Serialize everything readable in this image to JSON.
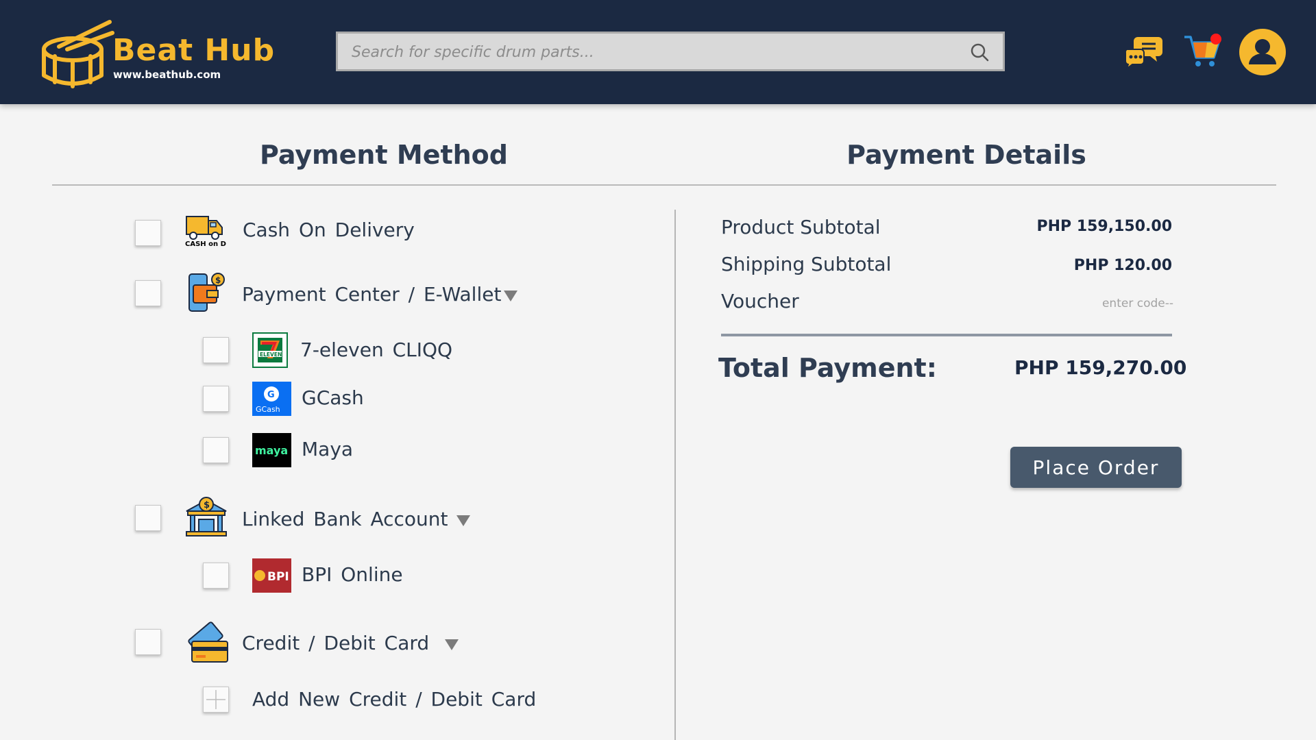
{
  "header": {
    "brand_name": "Beat Hub",
    "brand_url": "www.beathub.com",
    "search_placeholder": "Search for specific drum parts...",
    "cart_badge_color": "#ff1b1b",
    "brand_color": "#f5b82e",
    "background_color": "#1b2942"
  },
  "payment_method": {
    "title": "Payment Method",
    "options": [
      {
        "label": "Cash On  Delivery",
        "icon": "cash-on-delivery-van-icon",
        "icon_text": "CASH on DELIVERY"
      },
      {
        "label": "Payment Center /  E-Wallet",
        "icon": "e-wallet-phone-icon",
        "children": [
          {
            "label": "7-eleven CLIQQ",
            "icon": "seven-eleven-logo-icon",
            "icon_text": "ELEVEN"
          },
          {
            "label": "GCash",
            "icon": "gcash-logo-icon",
            "icon_text": "GCash"
          },
          {
            "label": "Maya",
            "icon": "maya-logo-icon",
            "icon_text": "maya"
          }
        ]
      },
      {
        "label": "Linked  Bank Account",
        "icon": "bank-building-icon",
        "children": [
          {
            "label": "BPI Online",
            "icon": "bpi-logo-icon",
            "icon_text": "BPI"
          }
        ]
      },
      {
        "label": "Credit /  Debit Card",
        "icon": "credit-card-icon",
        "children": [
          {
            "label": "Add  New Credit /  Debit Card",
            "icon": "plus-icon"
          }
        ]
      }
    ]
  },
  "payment_details": {
    "title": "Payment Details",
    "product_subtotal_label": "Product Subtotal",
    "product_subtotal_value": "PHP 159,150.00",
    "shipping_subtotal_label": "Shipping Subtotal",
    "shipping_subtotal_value": "PHP 120.00",
    "voucher_label": "Voucher",
    "voucher_placeholder": "enter code--",
    "total_label": "Total Payment:",
    "total_value": "PHP 159,270.00",
    "place_order_label": "Place Order"
  }
}
